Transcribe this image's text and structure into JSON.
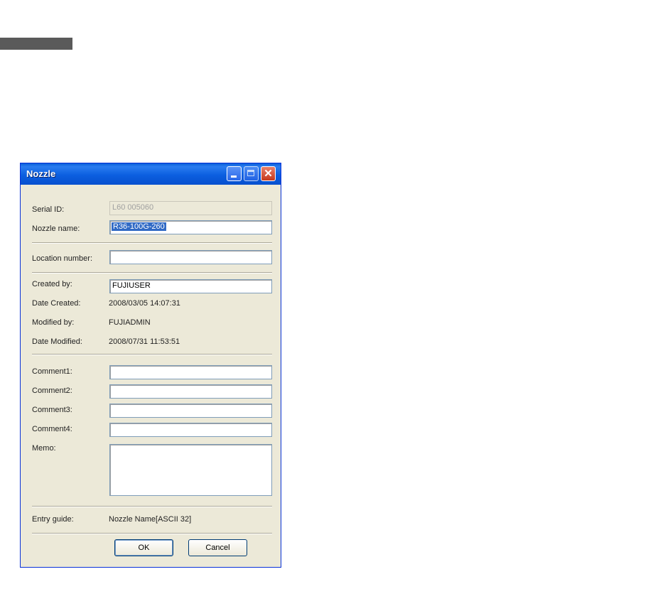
{
  "window": {
    "title": "Nozzle"
  },
  "form": {
    "serial_id": {
      "label": "Serial ID:",
      "value": "L60 005060"
    },
    "nozzle_name": {
      "label": "Nozzle name:",
      "value": "R36-100G-260"
    },
    "location_number": {
      "label": "Location number:",
      "value": ""
    },
    "created_by": {
      "label": "Created by:",
      "value": "FUJIUSER"
    },
    "date_created": {
      "label": "Date Created:",
      "value": "2008/03/05 14:07:31"
    },
    "modified_by": {
      "label": "Modified by:",
      "value": "FUJIADMIN"
    },
    "date_modified": {
      "label": "Date Modified:",
      "value": "2008/07/31 11:53:51"
    },
    "comment1": {
      "label": "Comment1:",
      "value": ""
    },
    "comment2": {
      "label": "Comment2:",
      "value": ""
    },
    "comment3": {
      "label": "Comment3:",
      "value": ""
    },
    "comment4": {
      "label": "Comment4:",
      "value": ""
    },
    "memo": {
      "label": "Memo:",
      "value": ""
    },
    "entry_guide": {
      "label": "Entry guide:",
      "value": "Nozzle Name[ASCII 32]"
    }
  },
  "buttons": {
    "ok": "OK",
    "cancel": "Cancel"
  }
}
